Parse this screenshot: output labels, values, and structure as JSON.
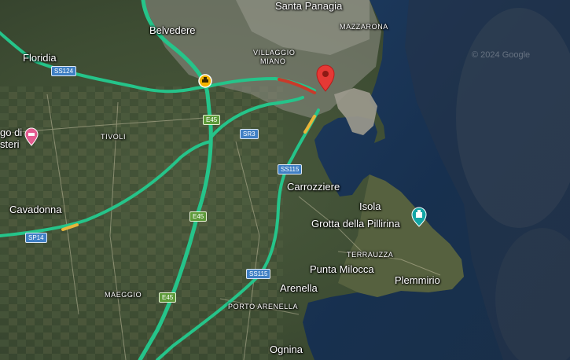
{
  "map": {
    "places": {
      "santa_panagia": "Santa Panagia",
      "belvedere": "Belvedere",
      "mazzarona": "MAZZARONA",
      "floridia": "Floridia",
      "villaggio_miano_1": "VILLAGGIO",
      "villaggio_miano_2": "MIANO",
      "tivoli": "TIVOLI",
      "borgo_di_1": "go di",
      "borgo_di_2": "steri",
      "carrozziere": "Carrozziere",
      "isola": "Isola",
      "grotta": "Grotta della Pillirina",
      "cavadonna": "Cavadonna",
      "terrauzza": "TERRAUZZA",
      "punta_milocca": "Punta Milocca",
      "plemmirio": "Plemmirio",
      "arenella": "Arenella",
      "maeggio": "MAEGGIO",
      "porto_arenella": "PORTO ARENELLA",
      "ognina": "Ognina"
    },
    "roads": {
      "ss124": "SS124",
      "e45_a": "E45",
      "e45_b": "E45",
      "e45_c": "E45",
      "sr3": "SR3",
      "ss115_a": "SS115",
      "ss115_b": "SS115",
      "sp14": "SP14"
    },
    "watermark": "© 2024 Google",
    "colors": {
      "traffic_free": "#25c48a",
      "traffic_slow": "#e8b53a",
      "traffic_heavy": "#c93a2a",
      "pin": "#e53935",
      "sea": "#16304f"
    },
    "icons": {
      "pin": "location-pin-icon",
      "incident": "road-incident-icon",
      "hotel": "hotel-icon",
      "landmark": "landmark-icon"
    }
  }
}
